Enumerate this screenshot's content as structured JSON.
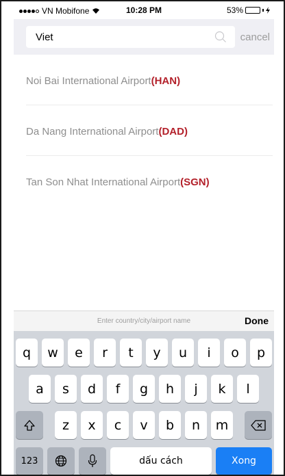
{
  "status_bar": {
    "carrier": "VN Mobifone",
    "time": "10:28 PM",
    "battery": "53%",
    "battery_level": 0.53,
    "icons": [
      "signal-dots-icon",
      "wifi-icon",
      "battery-icon",
      "charging-icon"
    ]
  },
  "search": {
    "value": "Viet",
    "cancel_label": "cancel",
    "icon": "search-icon"
  },
  "results": [
    {
      "name": "Noi Bai International Airport",
      "code": "(HAN)"
    },
    {
      "name": "Da Nang International Airport",
      "code": "(DAD)"
    },
    {
      "name": "Tan Son Nhat International Airport",
      "code": "(SGN)"
    }
  ],
  "keyboard_toolbar": {
    "hint": "Enter country/city/airport name",
    "done_label": "Done"
  },
  "keyboard": {
    "row1": [
      "q",
      "w",
      "e",
      "r",
      "t",
      "y",
      "u",
      "i",
      "o",
      "p"
    ],
    "row2": [
      "a",
      "s",
      "d",
      "f",
      "g",
      "h",
      "j",
      "k",
      "l"
    ],
    "row3": [
      "z",
      "x",
      "c",
      "v",
      "b",
      "n",
      "m"
    ],
    "numbers_label": "123",
    "space_label": "dấu cách",
    "return_label": "Xong",
    "icons": [
      "shift-icon",
      "backspace-icon",
      "globe-icon",
      "microphone-icon"
    ]
  },
  "colors": {
    "airport_code": "#b3202a",
    "return_key": "#1a7ff5",
    "header_bg": "#efeff4",
    "keyboard_bg": "#d1d5db"
  }
}
